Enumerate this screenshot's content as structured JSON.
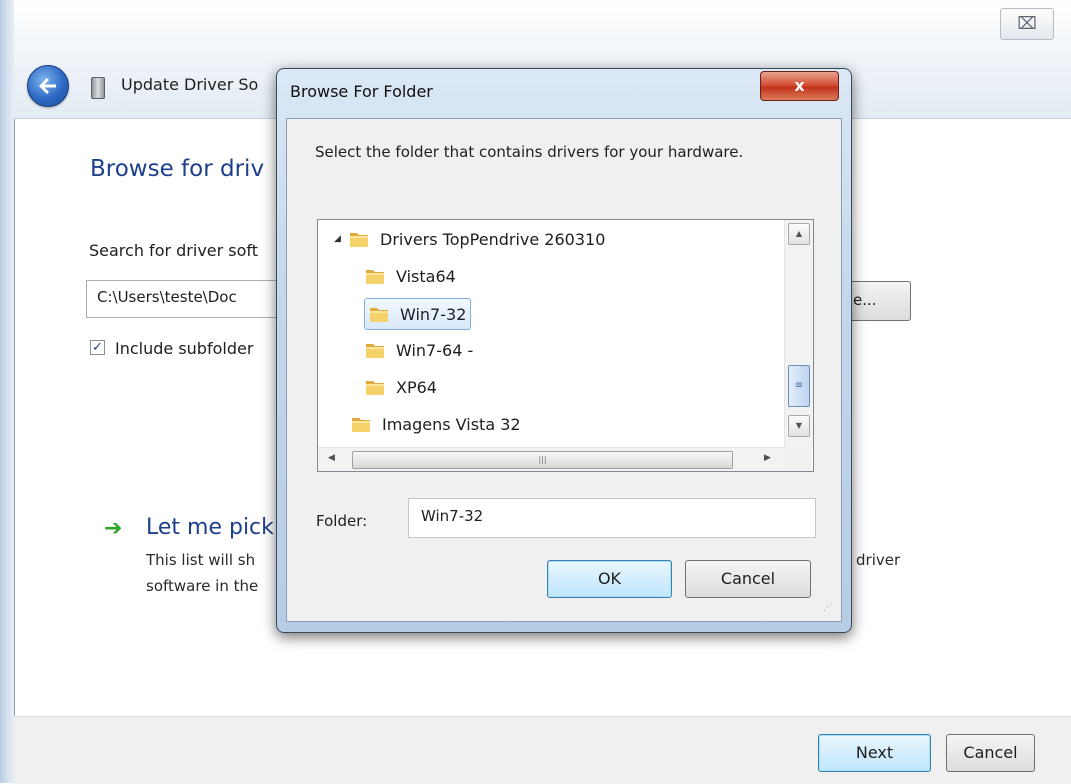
{
  "wizard": {
    "close_glyph": "⌧",
    "title": "Update Driver So",
    "heading": "Browse for driv",
    "search_label": "Search for driver soft",
    "path_value": "C:\\Users\\teste\\Doc",
    "browse_label": "e...",
    "include_subfolders_label": "Include subfolder",
    "include_subfolders_checked": true,
    "pick_heading": "Let me pick",
    "pick_desc_line1": "This list will sh",
    "pick_desc_line2": "software in the",
    "pick_desc_tail": "driver",
    "next_label": "Next",
    "cancel_label": "Cancel"
  },
  "dialog": {
    "title": "Browse For Folder",
    "close_glyph": "x",
    "instruction": "Select the folder that contains drivers for your hardware.",
    "tree": [
      {
        "label": "Drivers TopPendrive 260310",
        "level": 0,
        "expanded": true,
        "selected": false
      },
      {
        "label": "Vista64",
        "level": 1,
        "expanded": false,
        "selected": false
      },
      {
        "label": "Win7-32",
        "level": 1,
        "expanded": false,
        "selected": true
      },
      {
        "label": "Win7-64 -",
        "level": 1,
        "expanded": false,
        "selected": false
      },
      {
        "label": "XP64",
        "level": 1,
        "expanded": false,
        "selected": false
      },
      {
        "label": "Imagens Vista 32",
        "level": 0,
        "expanded": false,
        "selected": false
      }
    ],
    "folder_label": "Folder:",
    "folder_value": "Win7-32",
    "ok_label": "OK",
    "cancel_label": "Cancel"
  },
  "colors": {
    "heading_blue": "#1d3f8c",
    "folder_yellow": "#f2c94c",
    "close_red": "#c2321b"
  },
  "icons": [
    "back-arrow-icon",
    "device-icon",
    "green-arrow-icon",
    "folder-icon",
    "close-icon",
    "checkbox-icon"
  ]
}
